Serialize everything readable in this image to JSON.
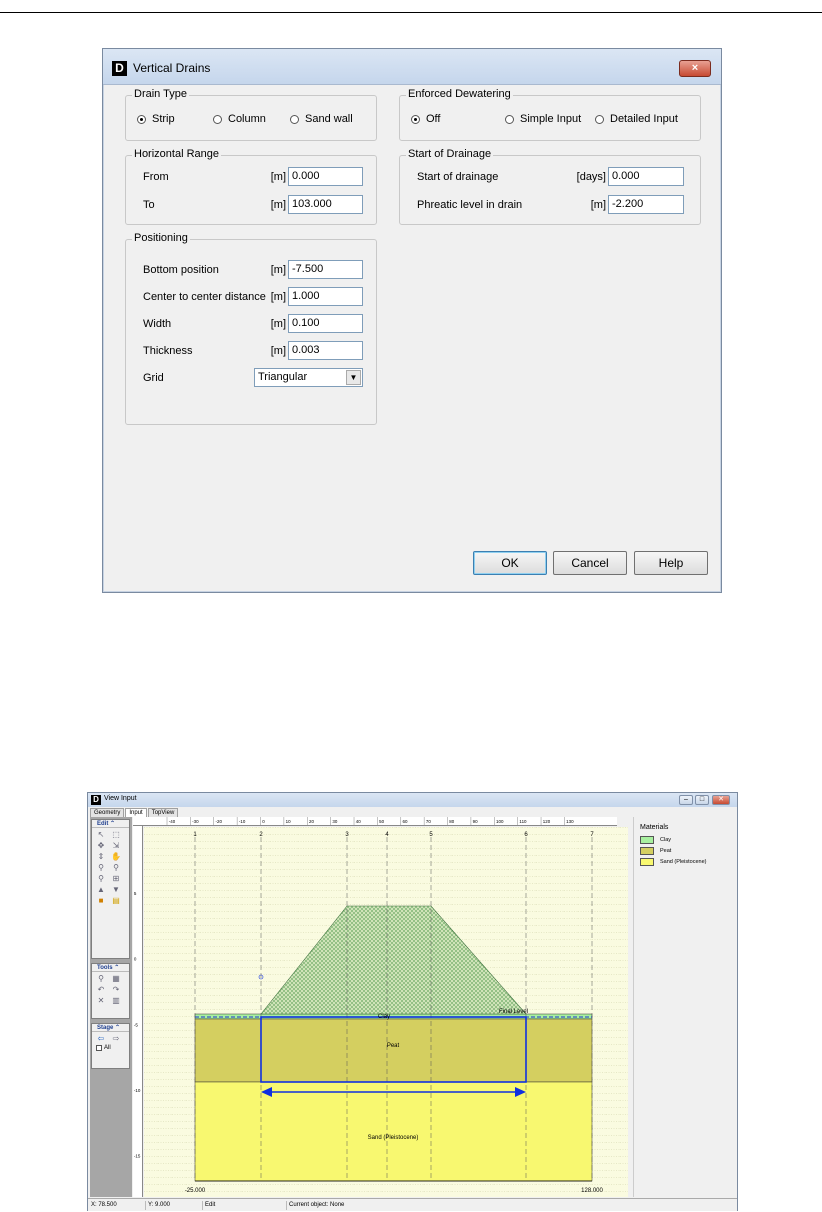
{
  "dialog": {
    "title": "Vertical Drains",
    "logo": "D",
    "close": "×",
    "drain_type": {
      "title": "Drain Type",
      "options": [
        "Strip",
        "Column",
        "Sand wall"
      ],
      "selected": "Strip"
    },
    "dewatering": {
      "title": "Enforced Dewatering",
      "options": [
        "Off",
        "Simple Input",
        "Detailed Input"
      ],
      "selected": "Off"
    },
    "horizontal_range": {
      "title": "Horizontal Range",
      "from_label": "From",
      "from_unit": "[m]",
      "from_value": "0.000",
      "to_label": "To",
      "to_unit": "[m]",
      "to_value": "103.000"
    },
    "start_of_drainage": {
      "title": "Start of Drainage",
      "start_label": "Start of drainage",
      "start_unit": "[days]",
      "start_value": "0.000",
      "phreatic_label": "Phreatic level in drain",
      "phreatic_unit": "[m]",
      "phreatic_value": "-2.200"
    },
    "positioning": {
      "title": "Positioning",
      "bottom_label": "Bottom position",
      "bottom_unit": "[m]",
      "bottom_value": "-7.500",
      "ctc_label": "Center to center distance",
      "ctc_unit": "[m]",
      "ctc_value": "1.000",
      "width_label": "Width",
      "width_unit": "[m]",
      "width_value": "0.100",
      "thickness_label": "Thickness",
      "thickness_unit": "[m]",
      "thickness_value": "0.003",
      "grid_label": "Grid",
      "grid_value": "Triangular"
    },
    "buttons": {
      "ok": "OK",
      "cancel": "Cancel",
      "help": "Help"
    }
  },
  "view_input": {
    "title": "View Input",
    "logo": "D",
    "window_buttons": {
      "minimize": "–",
      "maximize": "□",
      "close": "✕"
    },
    "tabs": [
      "Geometry",
      "Input",
      "TopView"
    ],
    "active_tab": "Input",
    "panels": {
      "edit": "Edit",
      "tools": "Tools",
      "stage": "Stage",
      "stage_all": "All"
    },
    "ruler_top": [
      "-40",
      "-30",
      "-20",
      "-10",
      "0",
      "10",
      "20",
      "30",
      "40",
      "50",
      "60",
      "70",
      "80",
      "90",
      "100",
      "110",
      "120",
      "130"
    ],
    "ruler_left": [
      "5",
      "0",
      "-5",
      "-10",
      "-15"
    ],
    "verticals": [
      "1",
      "2",
      "3",
      "4",
      "5",
      "6",
      "7"
    ],
    "layers": {
      "clay": "Clay",
      "peat": "Peat",
      "sand": "Sand (Pleistocene)",
      "final_level": "Final Level"
    },
    "x_left_label": "-25.000",
    "x_right_label": "128.000",
    "legend": {
      "title": "Materials",
      "items": [
        {
          "name": "Clay",
          "color": "#a8f0a0"
        },
        {
          "name": "Peat",
          "color": "#d4cf60"
        },
        {
          "name": "Sand (Pleistocene)",
          "color": "#f8f870"
        }
      ]
    },
    "status": {
      "x": "X: 78.500",
      "y": "Y: 9.000",
      "mode": "Edit",
      "object": "Current object: None"
    }
  }
}
